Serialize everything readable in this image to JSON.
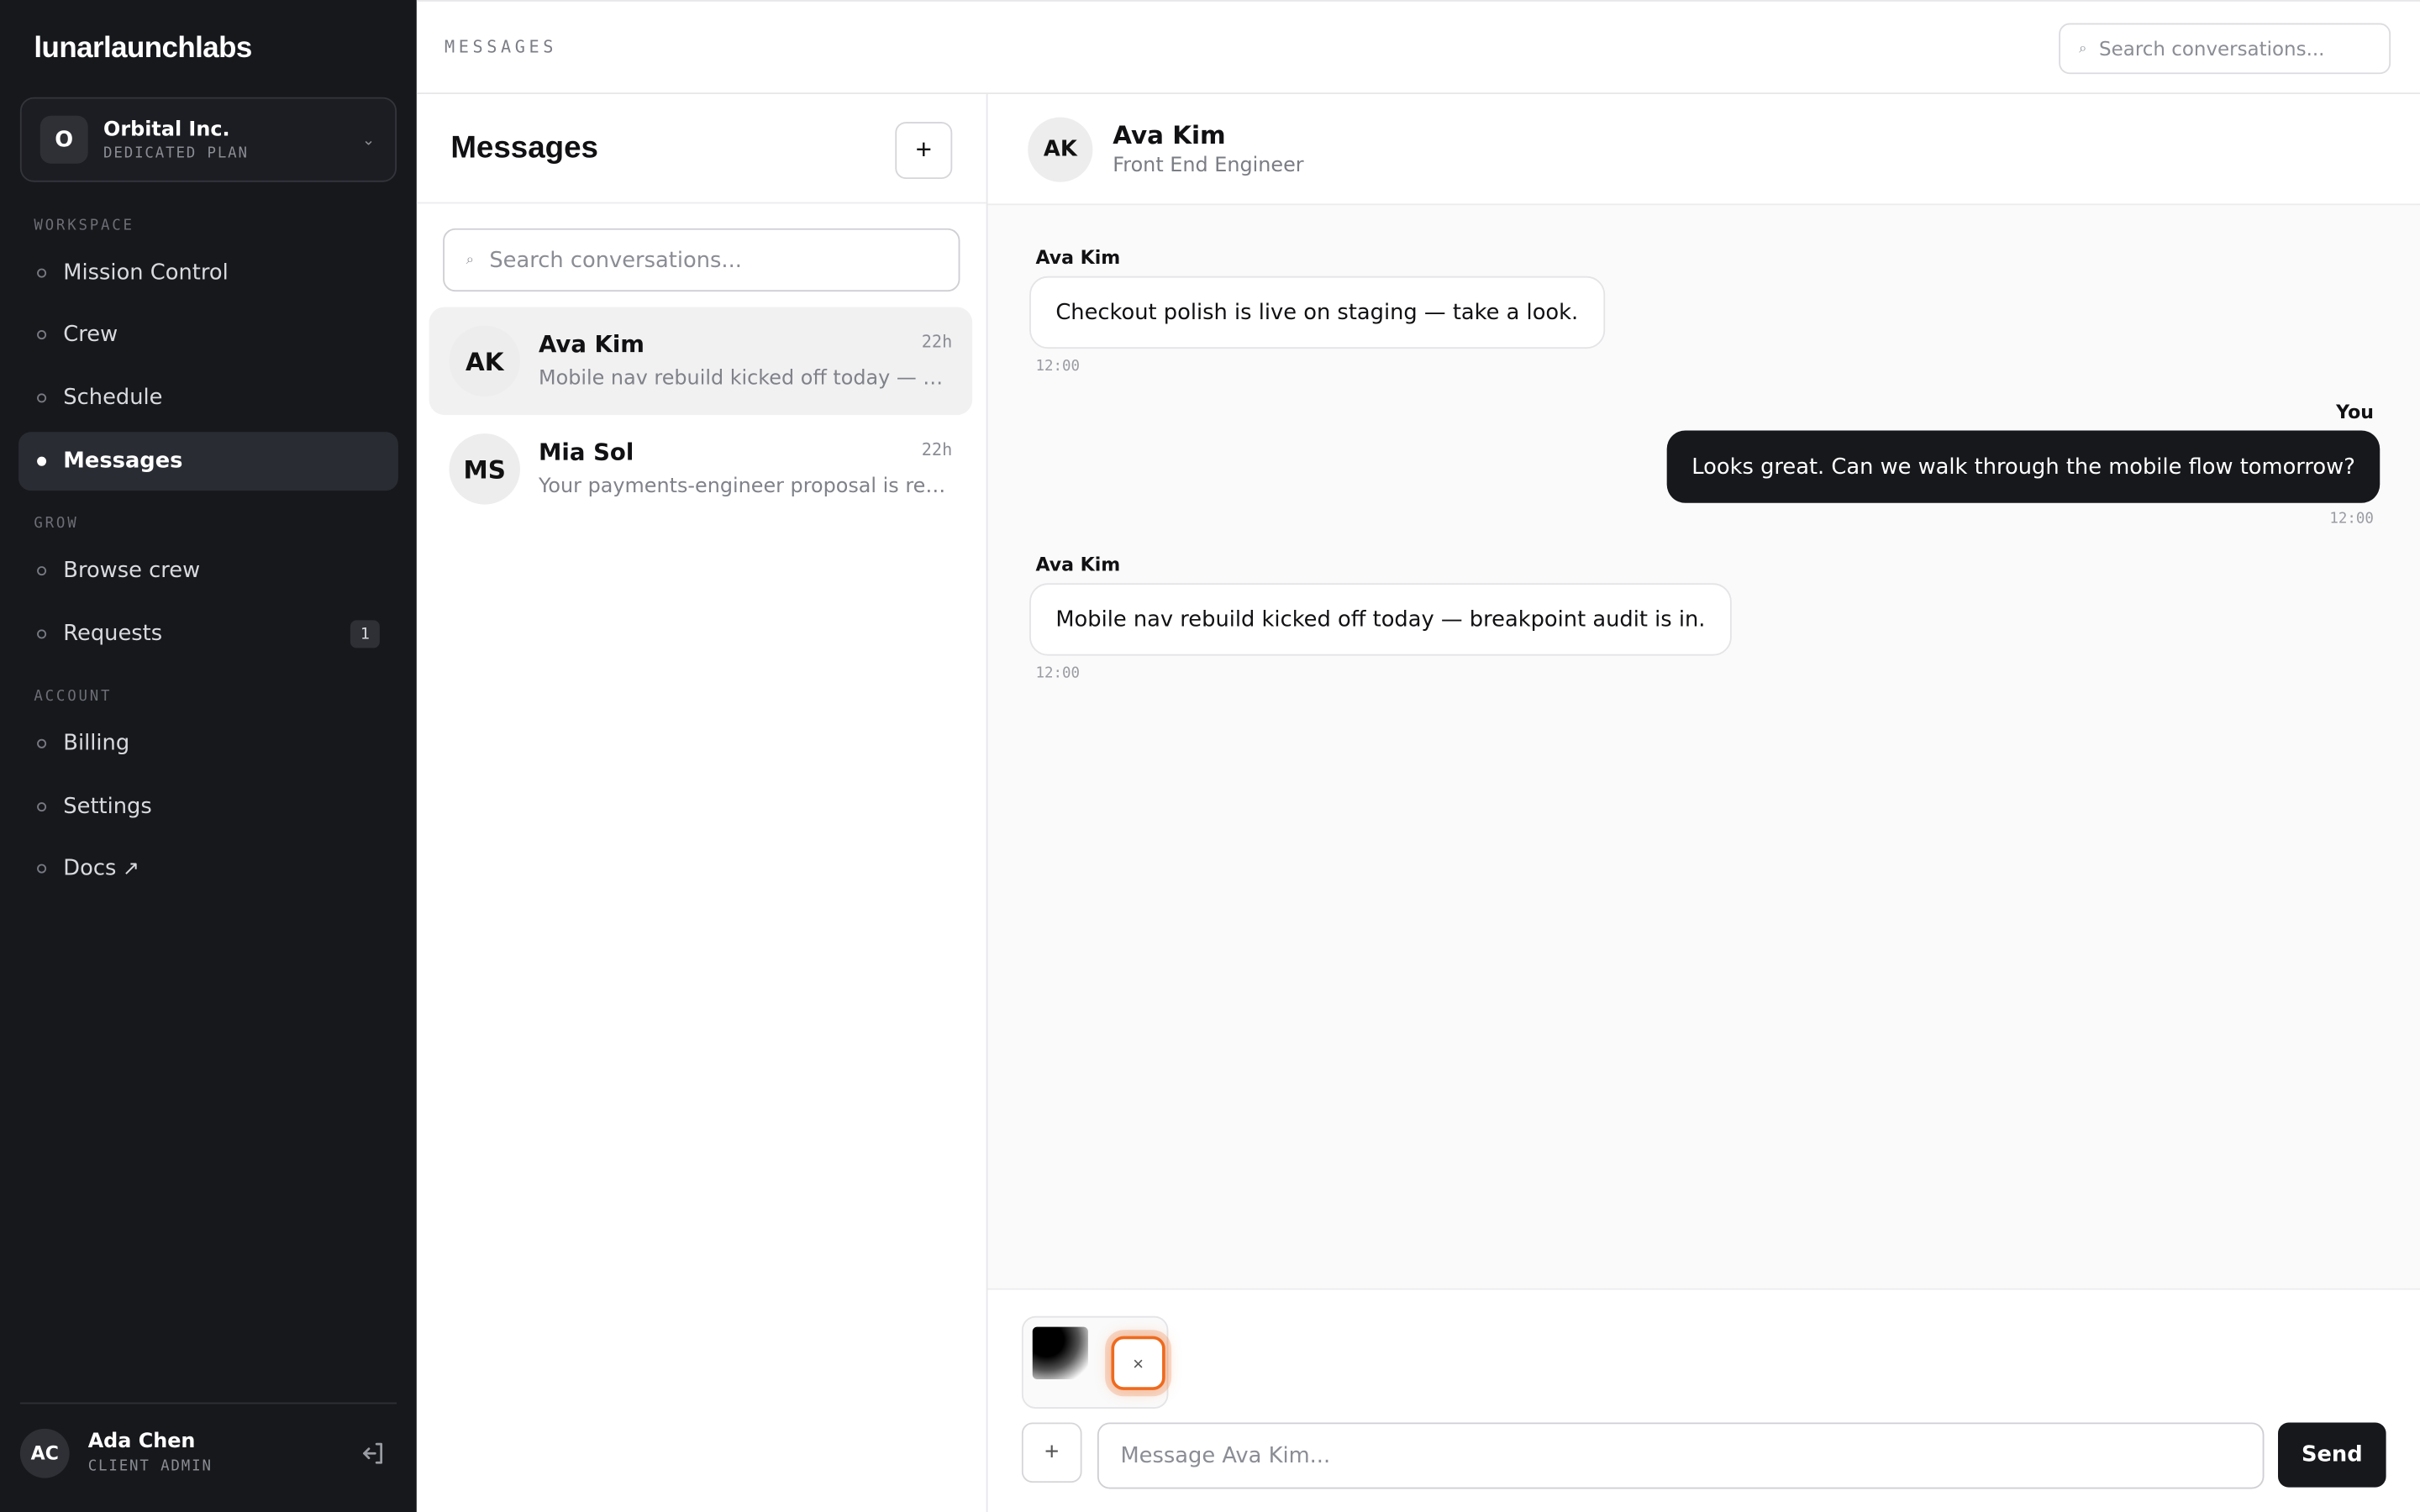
{
  "sidebar": {
    "brand": "lunarlaunchlabs",
    "org": {
      "initial": "O",
      "name": "Orbital Inc.",
      "plan": "DEDICATED PLAN"
    },
    "sections": {
      "workspace": "WORKSPACE",
      "grow": "GROW",
      "account": "ACCOUNT"
    },
    "items": {
      "mission_control": "Mission Control",
      "crew": "Crew",
      "schedule": "Schedule",
      "messages": "Messages",
      "browse_crew": "Browse crew",
      "requests": "Requests",
      "requests_badge": "1",
      "billing": "Billing",
      "settings": "Settings",
      "docs": "Docs",
      "docs_external_glyph": "↗"
    },
    "active_item": "Messages",
    "user": {
      "initials": "AC",
      "name": "Ada Chen",
      "role": "CLIENT ADMIN"
    }
  },
  "topbar": {
    "title": "MESSAGES",
    "search_placeholder": "Search conversations..."
  },
  "conversations": {
    "title": "Messages",
    "new_button": "+",
    "search_placeholder": "Search conversations...",
    "items": [
      {
        "initials": "AK",
        "name": "Ava Kim",
        "time": "22h",
        "preview": "Mobile nav rebuild kicked off today — breakpoint audit is in."
      },
      {
        "initials": "MS",
        "name": "Mia Sol",
        "time": "22h",
        "preview": "Your payments-engineer proposal is ready for review."
      }
    ]
  },
  "chat": {
    "contact": {
      "initials": "AK",
      "name": "Ava Kim",
      "role": "Front End Engineer"
    },
    "messages": [
      {
        "sender": "Ava Kim",
        "text": "Checkout polish is live on staging — take a look.",
        "time": "12:00",
        "direction": "in"
      },
      {
        "sender": "You",
        "text": "Looks great. Can we walk through the mobile flow tomorrow?",
        "time": "12:00",
        "direction": "out"
      },
      {
        "sender": "Ava Kim",
        "text": "Mobile nav rebuild kicked off today — breakpoint audit is in.",
        "time": "12:00",
        "direction": "in"
      }
    ],
    "composer": {
      "attach_remove_glyph": "×",
      "plus_glyph": "+",
      "placeholder": "Message Ava Kim...",
      "send_label": "Send"
    }
  },
  "icons": {
    "search": "search-icon",
    "chevron": "chevron-down-icon",
    "logout": "logout-icon",
    "external": "external-link-icon"
  },
  "colors": {
    "sidebar_bg": "#17181c",
    "accent_focus": "#ee6a1e",
    "outgoing_bubble": "#17181c"
  }
}
